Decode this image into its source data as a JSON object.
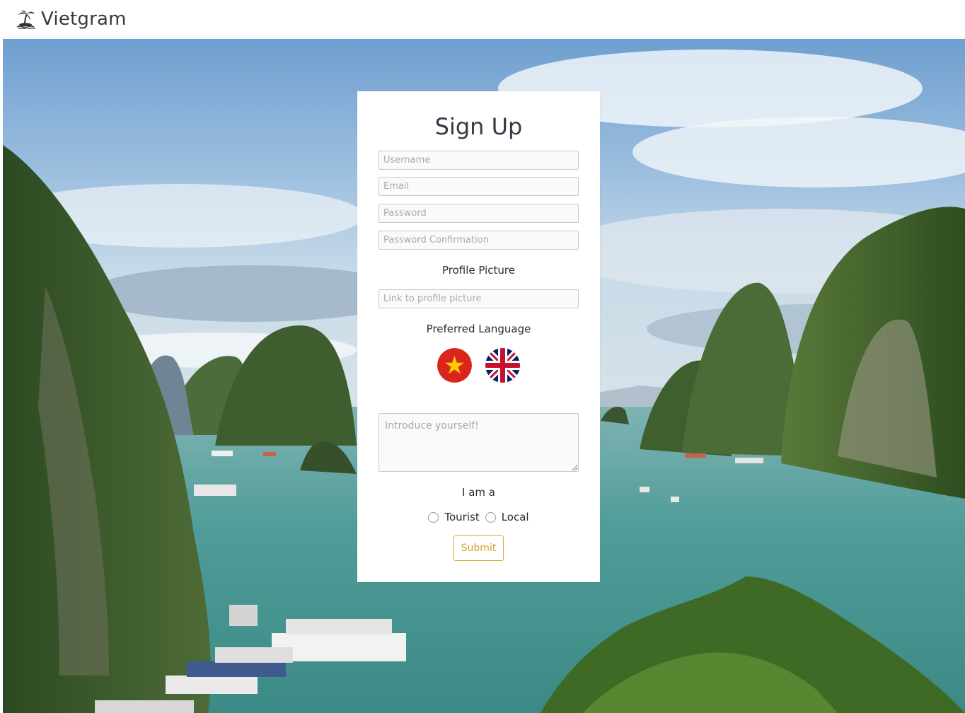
{
  "navbar": {
    "brand_icon": "palm-tree-island-icon",
    "brand_text": "Vietgram"
  },
  "form": {
    "title": "Sign Up",
    "username_placeholder": "Username",
    "email_placeholder": "Email",
    "password_placeholder": "Password",
    "password_confirmation_placeholder": "Password Confirmation",
    "profile_picture_label": "Profile Picture",
    "profile_picture_placeholder": "Link to profile picture",
    "language_label": "Preferred Language",
    "languages": [
      {
        "name": "vietnamese-flag-icon"
      },
      {
        "name": "uk-flag-icon"
      }
    ],
    "intro_placeholder": "Introduce yourself!",
    "role_label": "I am a",
    "role_options": [
      "Tourist",
      "Local"
    ],
    "submit_label": "Submit"
  },
  "colors": {
    "accent": "#d2a12c",
    "title_text": "#333b45",
    "vietnam_red": "#da251d",
    "vietnam_star": "#ffcd00",
    "uk_blue": "#012169",
    "uk_red": "#c8102e"
  }
}
